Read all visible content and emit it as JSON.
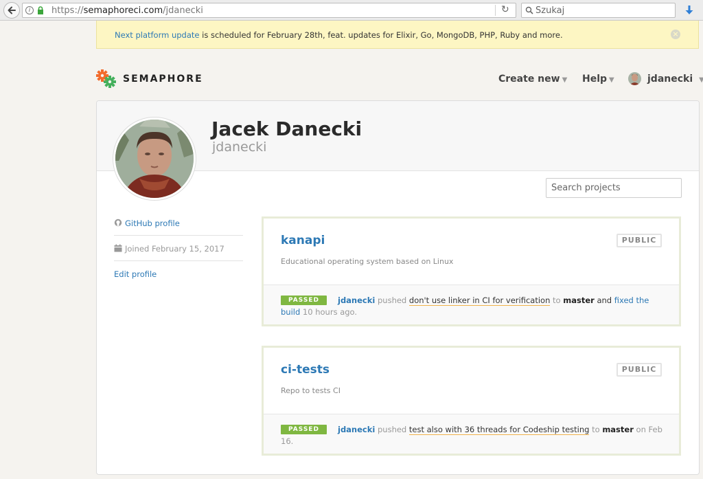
{
  "browser": {
    "url_prefix": "https://",
    "url_host": "semaphoreci.com",
    "url_path": "/jdanecki",
    "search_placeholder": "Szukaj"
  },
  "banner": {
    "link_text": "Next platform update",
    "message": " is scheduled for February 28th, feat. updates for Elixir, Go, MongoDB, PHP, Ruby and more."
  },
  "header": {
    "brand": "SEMAPHORE",
    "nav": {
      "create_new": "Create new",
      "help": "Help",
      "user": "jdanecki"
    }
  },
  "profile": {
    "name": "Jacek Danecki",
    "login": "jdanecki",
    "search_placeholder": "Search projects",
    "github_label": "GitHub profile",
    "joined": "Joined February 15, 2017",
    "edit_label": "Edit profile"
  },
  "projects": [
    {
      "name": "kanapi",
      "visibility": "PUBLIC",
      "description": "Educational operating system based on Linux",
      "build": {
        "status": "PASSED",
        "author": "jdanecki",
        "verb": " pushed ",
        "commit": "don't use linker in CI for verification",
        "to": " to ",
        "branch": "master",
        "and": " and ",
        "fix_text": "fixed the build",
        "when": " 10 hours ago."
      }
    },
    {
      "name": "ci-tests",
      "visibility": "PUBLIC",
      "description": "Repo to tests CI",
      "build": {
        "status": "PASSED",
        "author": "jdanecki",
        "verb": " pushed ",
        "commit": "test also with 36 threads for Codeship testing",
        "to": " to ",
        "branch": "master",
        "when": " on Feb 16."
      }
    }
  ],
  "colors": {
    "link": "#2d79b5",
    "passed": "#7fb741",
    "banner_bg": "#fdf6c3",
    "logo_orange": "#f26b2c",
    "logo_green": "#45b05d"
  }
}
